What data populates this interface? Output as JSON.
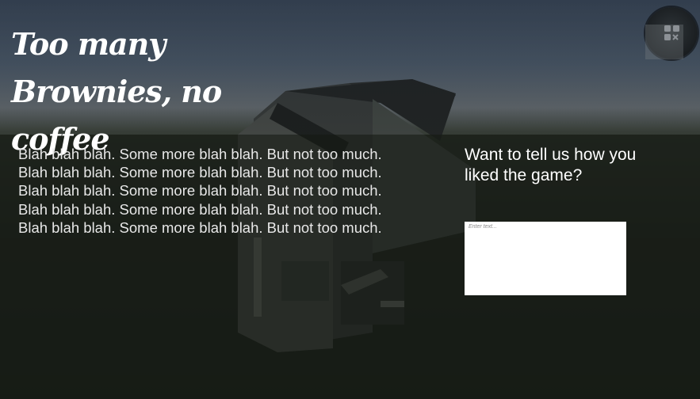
{
  "game": {
    "title_line1": "Too many",
    "title_line2": "Brownies, no coffee",
    "body_lines": [
      "Blah blah blah. Some more blah blah. But not too much.",
      "Blah blah blah. Some more blah blah. But not too much.",
      "Blah blah blah. Some more blah blah. But not too much.",
      "Blah blah blah. Some more blah blah. But not too much.",
      "Blah blah blah. Some more blah blah. But not too much."
    ],
    "feedback_prompt": "Want to tell us how you liked the game?",
    "feedback_placeholder": "Enter text...",
    "settings_icon": "settings-icon"
  }
}
